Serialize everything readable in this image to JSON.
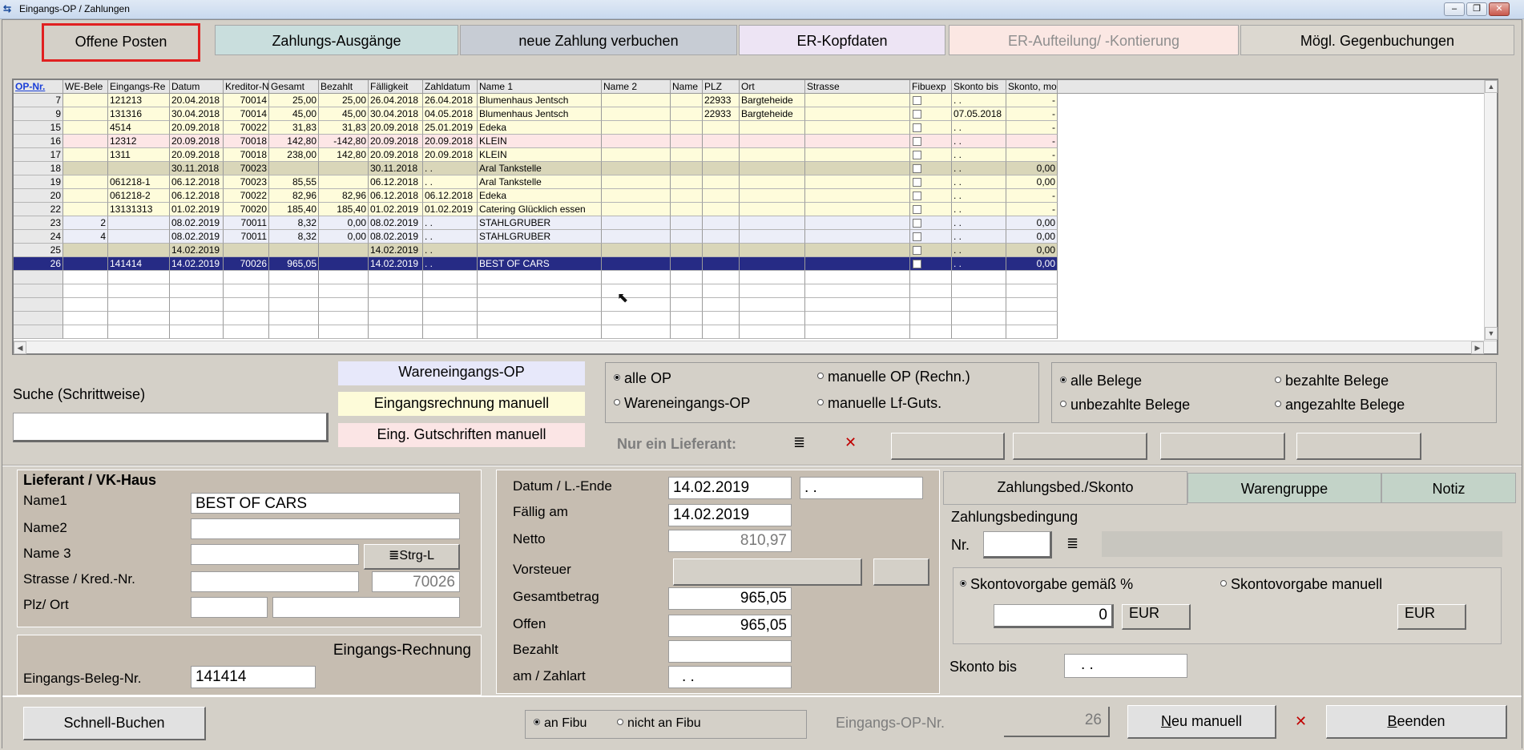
{
  "window": {
    "title": "Eingangs-OP / Zahlungen",
    "minimize": "–",
    "maximize": "❐",
    "close": "✕"
  },
  "tabs": [
    {
      "label": "Offene Posten",
      "bg": "#d4d0c8",
      "active": true
    },
    {
      "label": "Zahlungs-Ausgänge",
      "bg": "#c9dedd"
    },
    {
      "label": "neue Zahlung verbuchen",
      "bg": "#c7ccd4"
    },
    {
      "label": "ER-Kopfdaten",
      "bg": "#ede4f4"
    },
    {
      "label": "ER-Aufteilung/ -Kontierung",
      "bg": "#fbe7e3",
      "disabled": true
    },
    {
      "label": "Mögl. Gegenbuchungen",
      "bg": "#dcd8d0"
    }
  ],
  "grid": {
    "columns": [
      "OP-Nr.",
      "WE-Bele",
      "Eingangs-Re",
      "Datum",
      "Kreditor-N",
      "Gesamt",
      "Bezahlt",
      "Fälligkeit",
      "Zahldatum",
      "Name 1",
      "Name 2",
      "Name",
      "PLZ",
      "Ort",
      "Strasse",
      "Fibuexp",
      "Skonto bis",
      "Skonto, mo"
    ],
    "rows": [
      {
        "bg": "#fefcdb",
        "c": [
          "7",
          "",
          "121213",
          "20.04.2018",
          "70014",
          "25,00",
          "25,00",
          "26.04.2018",
          "26.04.2018",
          "Blumenhaus Jentsch",
          "",
          "",
          "22933",
          "Bargteheide",
          "",
          "",
          ". .",
          "-"
        ]
      },
      {
        "bg": "#fefcdb",
        "c": [
          "9",
          "",
          "131316",
          "30.04.2018",
          "70014",
          "45,00",
          "45,00",
          "30.04.2018",
          "04.05.2018",
          "Blumenhaus Jentsch",
          "",
          "",
          "22933",
          "Bargteheide",
          "",
          "",
          "07.05.2018",
          "-"
        ]
      },
      {
        "bg": "#fefcdb",
        "c": [
          "15",
          "",
          "4514",
          "20.09.2018",
          "70022",
          "31,83",
          "31,83",
          "20.09.2018",
          "25.01.2019",
          "Edeka",
          "",
          "",
          "",
          "",
          "",
          "",
          ". .",
          "-"
        ]
      },
      {
        "bg": "#fde6e6",
        "c": [
          "16",
          "",
          "12312",
          "20.09.2018",
          "70018",
          "142,80",
          "-142,80",
          "20.09.2018",
          "20.09.2018",
          "KLEIN",
          "",
          "",
          "",
          "",
          "",
          "",
          ". .",
          "-"
        ]
      },
      {
        "bg": "#fefcdb",
        "c": [
          "17",
          "",
          "1311",
          "20.09.2018",
          "70018",
          "238,00",
          "142,80",
          "20.09.2018",
          "20.09.2018",
          "KLEIN",
          "",
          "",
          "",
          "",
          "",
          "",
          ". .",
          "-"
        ]
      },
      {
        "bg": "#d9d6b9",
        "c": [
          "18",
          "",
          "",
          "30.11.2018",
          "70023",
          "",
          "",
          "30.11.2018",
          ". .",
          "Aral Tankstelle",
          "",
          "",
          "",
          "",
          "",
          "",
          ". .",
          "0,00"
        ]
      },
      {
        "bg": "#fefcdb",
        "c": [
          "19",
          "",
          "061218-1",
          "06.12.2018",
          "70023",
          "85,55",
          "",
          "06.12.2018",
          ". .",
          "Aral Tankstelle",
          "",
          "",
          "",
          "",
          "",
          "",
          ". .",
          "0,00"
        ]
      },
      {
        "bg": "#fefcdb",
        "c": [
          "20",
          "",
          "061218-2",
          "06.12.2018",
          "70022",
          "82,96",
          "82,96",
          "06.12.2018",
          "06.12.2018",
          "Edeka",
          "",
          "",
          "",
          "",
          "",
          "",
          ". .",
          "-"
        ]
      },
      {
        "bg": "#fefcdb",
        "c": [
          "22",
          "",
          "13131313",
          "01.02.2019",
          "70020",
          "185,40",
          "185,40",
          "01.02.2019",
          "01.02.2019",
          "Catering Glücklich essen",
          "",
          "",
          "",
          "",
          "",
          "",
          ". .",
          "-"
        ]
      },
      {
        "bg": "#eceef8",
        "c": [
          "23",
          "2",
          "",
          "08.02.2019",
          "70011",
          "8,32",
          "0,00",
          "08.02.2019",
          ". .",
          "STAHLGRUBER",
          "",
          "",
          "",
          "",
          "",
          "",
          ". .",
          "0,00"
        ]
      },
      {
        "bg": "#eceef8",
        "c": [
          "24",
          "4",
          "",
          "08.02.2019",
          "70011",
          "8,32",
          "0,00",
          "08.02.2019",
          ". .",
          "STAHLGRUBER",
          "",
          "",
          "",
          "",
          "",
          "",
          ". .",
          "0,00"
        ]
      },
      {
        "bg": "#d9d6b9",
        "c": [
          "25",
          "",
          "",
          "14.02.2019",
          "",
          "",
          "",
          "14.02.2019",
          ". .",
          "",
          "",
          "",
          "",
          "",
          "",
          "",
          ". .",
          "0,00"
        ]
      },
      {
        "bg": "#262b85",
        "selected": true,
        "c": [
          "26",
          "",
          "141414",
          "14.02.2019",
          "70026",
          "965,05",
          "",
          "14.02.2019",
          ". .",
          "BEST OF CARS",
          "",
          "",
          "",
          "",
          "",
          "",
          ". .",
          "0,00"
        ]
      }
    ]
  },
  "search": {
    "label": "Suche (Schrittweise)",
    "value": ""
  },
  "legend": {
    "we": "Wareneingangs-OP",
    "er": "Eingangsrechnung manuell",
    "gs": "Eing. Gutschriften manuell"
  },
  "op_filter": {
    "alle": "alle OP",
    "manuell_op": "manuelle OP (Rechn.)",
    "we": "Wareneingangs-OP",
    "manuell_lf": "manuelle Lf-Guts."
  },
  "beleg_filter": {
    "alle": "alle Belege",
    "bezahlt": "bezahlte Belege",
    "unbezahlt": "unbezahlte Belege",
    "angezahlt": "angezahlte Belege"
  },
  "lieferant_filter": {
    "label": "Nur ein Lieferant:",
    "list_icon": "≣",
    "clear_icon": "✕"
  },
  "lieferant": {
    "header": "Lieferant / VK-Haus",
    "name1_label": "Name1",
    "name1": "BEST OF CARS",
    "name2_label": "Name2",
    "name2": "",
    "name3_label": "Name 3",
    "name3": "",
    "strg_label": "Strg-L",
    "strg_icon": "≣",
    "strasse_label": "Strasse / Kred.-Nr.",
    "strasse": "",
    "kred_nr": "70026",
    "plz_label": "Plz/ Ort",
    "plz": "",
    "ort": ""
  },
  "eingang": {
    "header": "Eingangs-Rechnung",
    "beleg_label": "Eingangs-Beleg-Nr.",
    "beleg_nr": "141414"
  },
  "betraege": {
    "datum_label": "Datum / L.-Ende",
    "datum": "14.02.2019",
    "l_ende": ". .",
    "faellig_label": "Fällig am",
    "faellig": "14.02.2019",
    "netto_label": "Netto",
    "netto": "810,97",
    "vorsteuer_label": "Vorsteuer",
    "gesamt_label": "Gesamtbetrag",
    "gesamt": "965,05",
    "offen_label": "Offen",
    "offen": "965,05",
    "bezahlt_label": "Bezahlt",
    "bezahlt": "",
    "am_label": "am / Zahlart",
    "am": ". ."
  },
  "subtabs": [
    {
      "label": "Zahlungsbed./Skonto",
      "bg": "#d4d0c8",
      "active": true
    },
    {
      "label": "Warengruppe",
      "bg": "#c3d3c8"
    },
    {
      "label": "Notiz",
      "bg": "#c3d3c8"
    }
  ],
  "zahlung": {
    "header": "Zahlungsbedingung",
    "nr_label": "Nr.",
    "nr": "",
    "list_icon": "≣",
    "skonto_pct_label": "Skontovorgabe gemäß %",
    "skonto_man_label": "Skontovorgabe manuell",
    "skonto_value": "0",
    "eur1": "EUR",
    "eur2": "EUR",
    "skonto_bis_label": "Skonto bis",
    "skonto_bis": ". ."
  },
  "footer": {
    "schnell": "Schnell-Buchen",
    "an_fibu": "an Fibu",
    "nicht_fibu": "nicht an Fibu",
    "op_nr_label": "Eingangs-OP-Nr.",
    "op_nr": "26",
    "neu": "Neu manuell",
    "neu_underline": "N",
    "x_icon": "✕",
    "beenden": "Beenden",
    "beenden_underline": "B"
  }
}
